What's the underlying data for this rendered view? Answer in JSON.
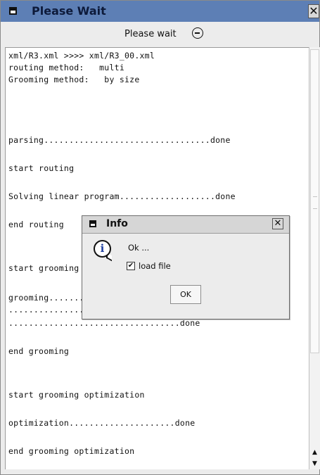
{
  "window": {
    "title": "Please Wait",
    "close_glyph": "✕",
    "status_text": "Please wait",
    "icons": [
      "window-menu-icon",
      "close-icon",
      "busy-clock-icon"
    ]
  },
  "log": {
    "lines": [
      "xml/R3.xml >>>> xml/R3_00.xml",
      "routing method:   multi",
      "Grooming method:   by size",
      "parsing.................................done",
      "start routing",
      "Solving linear program...................done",
      "end routing",
      "start grooming",
      "grooming.....................................",
      "......................................................",
      "..................................done",
      "end grooming",
      "start grooming optimization",
      "optimization.....................done",
      "end grooming optimization"
    ]
  },
  "scrollbar": {
    "up_glyph": "▲",
    "down_glyph": "▼"
  },
  "dialog": {
    "title": "Info",
    "close_glyph": "✕",
    "message": "Ok ...",
    "checkbox_label": "load file",
    "checkbox_checked": true,
    "checkbox_glyph": "✔",
    "ok_label": "OK",
    "info_glyph": "i"
  }
}
